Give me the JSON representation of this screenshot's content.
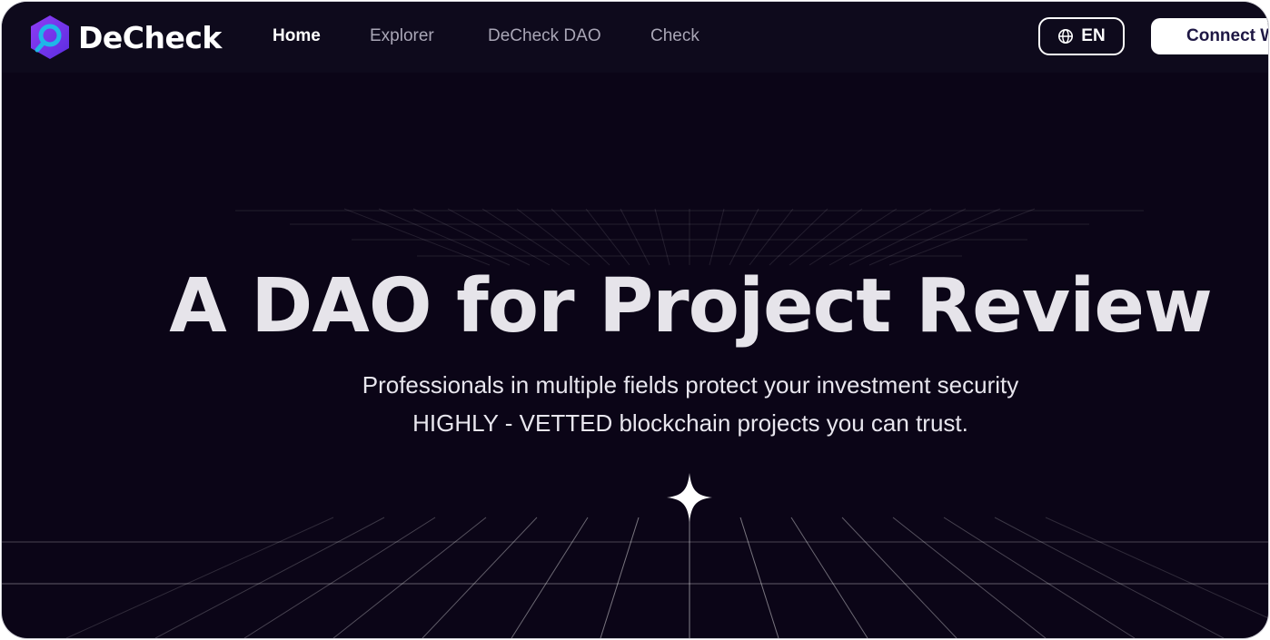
{
  "brand": {
    "name": "DeCheck",
    "icon": "magnifier-hexagon-logo",
    "accent_colors": [
      "#7b3cf0",
      "#1fb6e8"
    ]
  },
  "nav": {
    "items": [
      {
        "label": "Home",
        "active": true
      },
      {
        "label": "Explorer",
        "active": false
      },
      {
        "label": "DeCheck DAO",
        "active": false
      },
      {
        "label": "Check",
        "active": false
      }
    ],
    "language": {
      "label": "EN",
      "icon": "globe-icon"
    },
    "connect_label": "Connect W"
  },
  "hero": {
    "title": "A DAO for Project Review",
    "line1": "Professionals in multiple fields protect your investment security",
    "line2": "HIGHLY - VETTED blockchain projects you can trust.",
    "decoration_icon": "sparkle-star-icon"
  },
  "colors": {
    "background": "#0b0517",
    "navbar": "#0e0a1c",
    "text": "#ffffff",
    "muted_text": "#a9a6b6"
  }
}
